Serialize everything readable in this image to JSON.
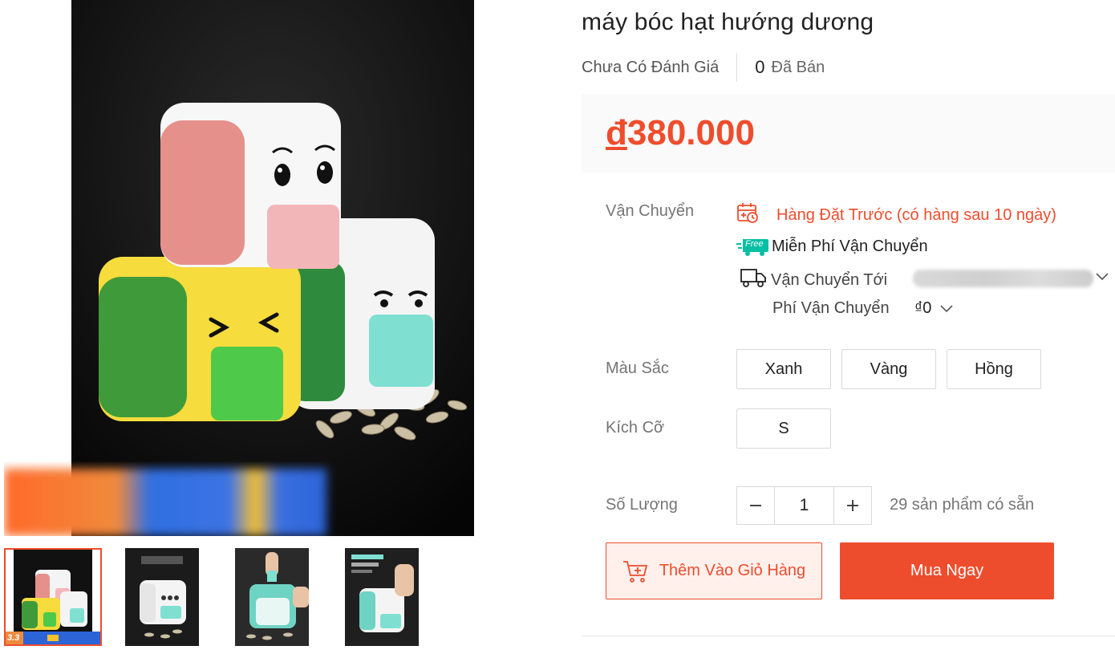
{
  "product": {
    "title": "máy bóc hạt hướng dương",
    "rating_text": "Chưa Có Đánh Giá",
    "sold_count": "0",
    "sold_label": "Đã Bán",
    "price_currency": "đ",
    "price_amount": "380.000"
  },
  "shipping": {
    "label": "Vận Chuyển",
    "preorder_text": "Hàng Đặt Trước (có hàng sau 10 ngày)",
    "free_badge": "Free",
    "free_shipping_text": "Miễn Phí Vận Chuyển",
    "ship_to_label": "Vận Chuyển Tới",
    "fee_label": "Phí Vận Chuyển",
    "fee_value": "₫0"
  },
  "options": {
    "color_label": "Màu Sắc",
    "colors": [
      "Xanh",
      "Vàng",
      "Hồng"
    ],
    "size_label": "Kích Cỡ",
    "sizes": [
      "S"
    ]
  },
  "quantity": {
    "label": "Số Lượng",
    "value": "1",
    "stock_text": "29 sản phẩm có sẵn"
  },
  "actions": {
    "add_to_cart": "Thêm Vào Giỏ Hàng",
    "buy_now": "Mua Ngay"
  },
  "gallery": {
    "selected_index": 0,
    "thumbnail_count": 4,
    "thumb_badge": "3.3"
  },
  "colors": {
    "accent": "#ee4d2d",
    "free_badge": "#00bfa5"
  }
}
